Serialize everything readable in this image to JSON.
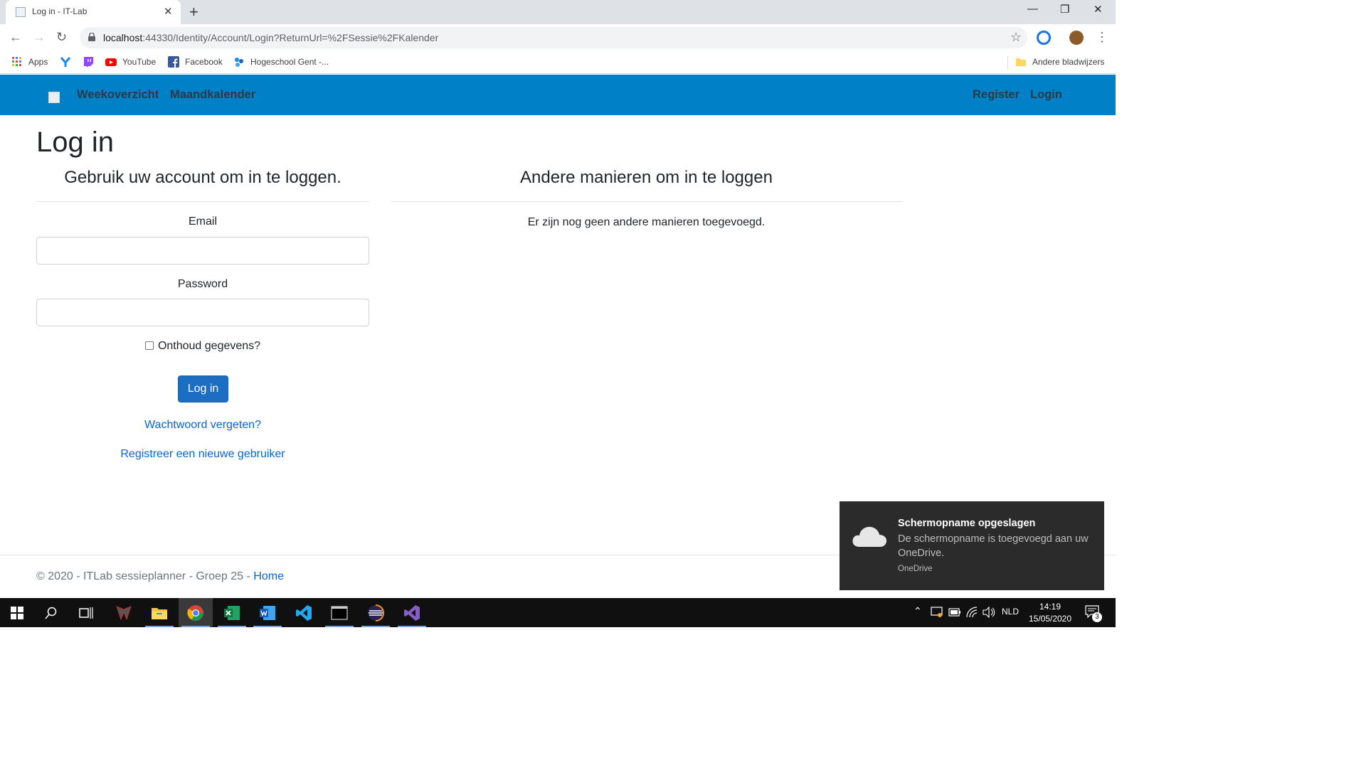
{
  "browser": {
    "tab_title": "Log in - IT-Lab",
    "url_host": "localhost",
    "url_rest": ":44330/Identity/Account/Login?ReturnUrl=%2FSessie%2FKalender",
    "bookmarks": [
      "Apps",
      "YouTube",
      "Facebook",
      "Hogeschool Gent -..."
    ],
    "other_bookmarks": "Andere bladwijzers"
  },
  "navbar": {
    "links": [
      "Weekoverzicht",
      "Maandkalender"
    ],
    "register": "Register",
    "login": "Login"
  },
  "page": {
    "title": "Log in",
    "left_heading": "Gebruik uw account om in te loggen.",
    "right_heading": "Andere manieren om in te loggen",
    "email_label": "Email",
    "password_label": "Password",
    "remember_label": "Onthoud gegevens?",
    "login_button": "Log in",
    "forgot_link": "Wachtwoord vergeten?",
    "register_link": "Registreer een nieuwe gebruiker",
    "other_message": "Er zijn nog geen andere manieren toegevoegd."
  },
  "footer": {
    "text": "© 2020 - ITLab sessieplanner - Groep 25 -",
    "home_link": "Home"
  },
  "toast": {
    "title": "Schermopname opgeslagen",
    "body": "De schermopname is toegevoegd aan uw OneDrive.",
    "source": "OneDrive"
  },
  "taskbar": {
    "language": "NLD",
    "time": "14:19",
    "date": "15/05/2020",
    "notifications": "3"
  },
  "colors": {
    "navbar": "#0080c6",
    "primary_button": "#1b6ec2",
    "link": "#0366d6"
  }
}
